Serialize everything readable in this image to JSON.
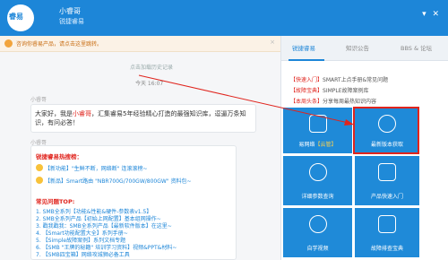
{
  "app": {
    "logo_text": "睿易",
    "name": "小睿哥",
    "subtitle": "锐捷睿易",
    "window_controls": "▾ ✕"
  },
  "notice": {
    "text": "咨询你睿易产品，请点击这里跳转。",
    "close": "×"
  },
  "chat": {
    "history_link": "点击加载历史记录",
    "timestamp": "今天 16:07",
    "sender_1": "小睿哥",
    "greeting_a": "大家好，我是",
    "greeting_name": "小睿哥",
    "greeting_b": "，汇集睿易5年经验精心打造的最强知识库，逗逼万条知识，有问必答！",
    "sender_2": "小睿哥",
    "hot_title": "锐捷睿易热搜榜：",
    "hot_1_tag": "【新功能】",
    "hot_1_text": "\"生鲜不断，网络断\" 连滚滚榜~",
    "hot_2_tag": "【新品】",
    "hot_2_text": "Smart路由 \"NBR700G/700GW/800GW\" 资料包~",
    "faq_title": "常见问题TOP:",
    "faq": [
      "1. SMB全系列【功能&性能&硬件-参数表v1.5】",
      "2. SMB全系列产品【初始上网配置】基本组网操作~",
      "3. 戳我戳我：SMB全系列产品【最新软件版本】在这里~",
      "4. 【Smart功能配置大全】系列手册~",
      "5. 【Simple故障案例】系列文档专题",
      "6. 【SMB \"王牌的秘籍\" 培训学习资料】视频&PPT&材料~",
      "7. 【SMB四宝箱】网络攻城狮必备工具"
    ]
  },
  "panel": {
    "tabs": [
      "锐捷睿易",
      "知识公告",
      "BBS & 论坛"
    ],
    "quick_links": [
      {
        "tag": "【快速入门】",
        "text": "SMART上点手册&常见问题"
      },
      {
        "tag": "【故障宝典】",
        "text": "SIMPLE故障案例库"
      },
      {
        "tag": "【本周头条】",
        "text": "分享每周最热知识内容"
      }
    ],
    "tiles": [
      {
        "label_a": "易网络",
        "label_hl": "【云管】"
      },
      {
        "label_a": "最新版本获取",
        "label_hl": ""
      },
      {
        "label_a": "详细参数查询",
        "label_hl": ""
      },
      {
        "label_a": "产品快速入门",
        "label_hl": ""
      },
      {
        "label_a": "自学视频",
        "label_hl": ""
      },
      {
        "label_a": "故障排查宝典",
        "label_hl": ""
      }
    ]
  },
  "colors": {
    "brand_blue": "#1d86d8",
    "tile_blue": "#1f8ad8",
    "highlight_red": "#e0241d"
  }
}
